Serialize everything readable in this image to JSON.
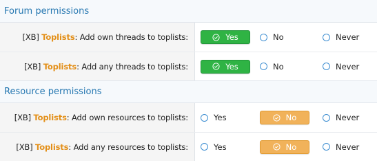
{
  "sections": [
    {
      "title": "Forum permissions",
      "rows": [
        {
          "addon": "[XB]",
          "bold": "Toplists",
          "text": ": Add own threads to toplists:",
          "options": [
            "Yes",
            "No",
            "Never"
          ],
          "selected": "Yes"
        },
        {
          "addon": "[XB]",
          "bold": "Toplists",
          "text": ": Add any threads to toplists:",
          "options": [
            "Yes",
            "No",
            "Never"
          ],
          "selected": "Yes"
        }
      ]
    },
    {
      "title": "Resource permissions",
      "rows": [
        {
          "addon": "[XB]",
          "bold": "Toplists",
          "text": ": Add own resources to toplists:",
          "options": [
            "Yes",
            "No",
            "Never"
          ],
          "selected": "No"
        },
        {
          "addon": "[XB]",
          "bold": "Toplists",
          "text": ": Add any resources to toplists:",
          "options": [
            "Yes",
            "No",
            "Never"
          ],
          "selected": "No"
        }
      ]
    }
  ],
  "colors": {
    "header_text": "#2577b1",
    "bold_label": "#e38f18",
    "yes_selected": "#2fb344",
    "no_selected": "#f1b25a",
    "radio_border": "#3f8fd2"
  },
  "icons": {
    "selected": "check-circle-icon",
    "unselected": "radio-circle-icon"
  }
}
